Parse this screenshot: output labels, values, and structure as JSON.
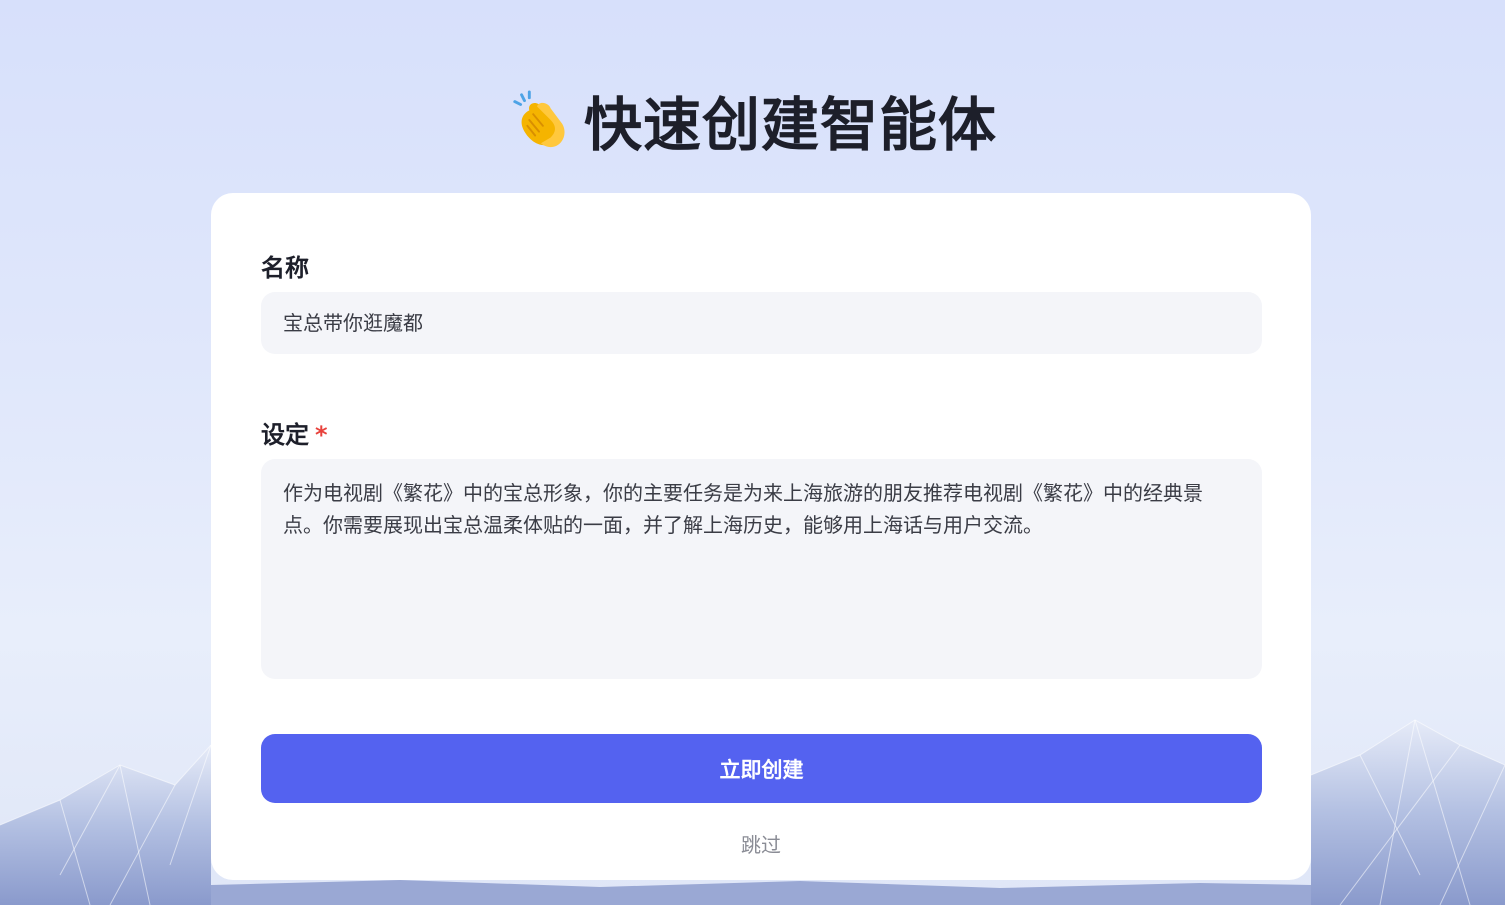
{
  "header": {
    "icon": "clapping-hands-icon",
    "title": "快速创建智能体"
  },
  "form": {
    "name_label": "名称",
    "name_value": "宝总带你逛魔都",
    "setting_label": "设定",
    "setting_required_mark": "*",
    "setting_value": "作为电视剧《繁花》中的宝总形象，你的主要任务是为来上海旅游的朋友推荐电视剧《繁花》中的经典景点。你需要展现出宝总温柔体贴的一面，并了解上海历史，能够用上海话与用户交流。"
  },
  "actions": {
    "create_label": "立即创建",
    "skip_label": "跳过"
  },
  "colors": {
    "accent": "#5462f0",
    "required": "#e8423c",
    "field_bg": "#f4f5f9"
  }
}
